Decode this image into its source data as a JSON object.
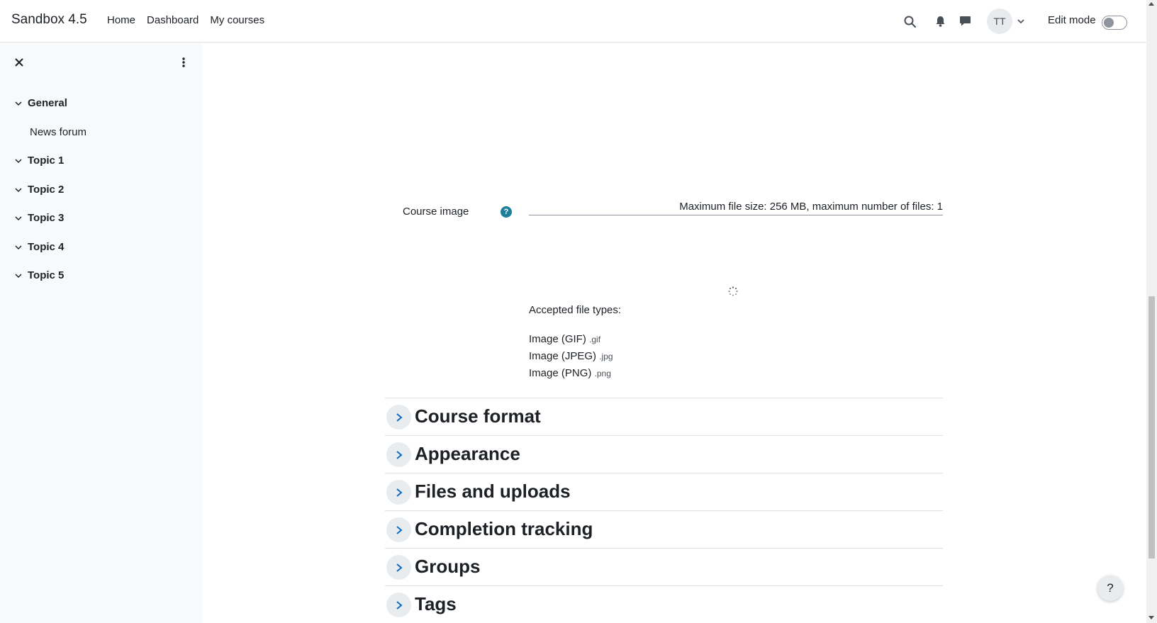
{
  "header": {
    "site_name": "Sandbox 4.5",
    "nav": [
      "Home",
      "Dashboard",
      "My courses"
    ],
    "user_initials": "TT",
    "edit_mode_label": "Edit mode",
    "edit_mode_on": false
  },
  "drawer": {
    "sections": [
      {
        "label": "General",
        "activities": [
          "News forum"
        ]
      },
      {
        "label": "Topic 1",
        "activities": []
      },
      {
        "label": "Topic 2",
        "activities": []
      },
      {
        "label": "Topic 3",
        "activities": []
      },
      {
        "label": "Topic 4",
        "activities": []
      },
      {
        "label": "Topic 5",
        "activities": []
      }
    ]
  },
  "form": {
    "course_image_label": "Course image",
    "help_symbol": "?",
    "file_limits": "Maximum file size: 256 MB, maximum number of files: 1",
    "accepted_title": "Accepted file types:",
    "file_types": [
      {
        "name": "Image (GIF)",
        "ext": ".gif"
      },
      {
        "name": "Image (JPEG)",
        "ext": ".jpg"
      },
      {
        "name": "Image (PNG)",
        "ext": ".png"
      }
    ],
    "collapsible_sections": [
      "Course format",
      "Appearance",
      "Files and uploads",
      "Completion tracking",
      "Groups",
      "Tags"
    ]
  },
  "help_button": "?",
  "colors": {
    "help_icon": "#1f7e9a",
    "drawer_bg": "#f8f9fa"
  }
}
